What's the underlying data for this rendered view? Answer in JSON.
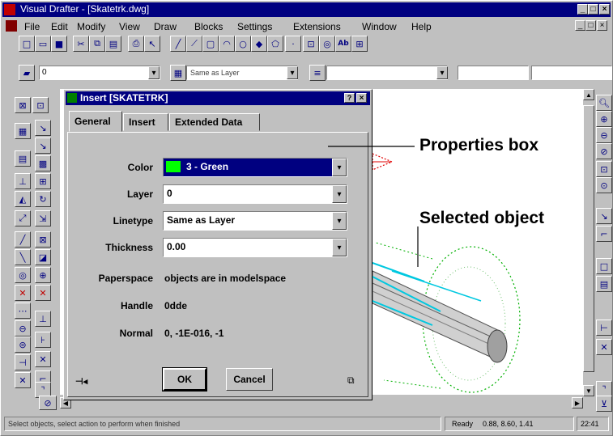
{
  "window": {
    "title": "Visual Drafter - [Skatetrk.dwg]"
  },
  "menu": [
    "File",
    "Edit",
    "Modify",
    "View",
    "Draw",
    "Blocks",
    "Settings",
    "Extensions",
    "Window",
    "Help"
  ],
  "toolbar2": {
    "layer_field": "0",
    "layer_combo": "Same as Layer"
  },
  "dialog": {
    "title": "Insert [SKATETRK]",
    "tabs": [
      "General",
      "Insert",
      "Extended Data"
    ],
    "color_label": "Color",
    "color_value": "3 - Green",
    "color_swatch": "#00ff00",
    "layer_label": "Layer",
    "layer_value": "0",
    "linetype_label": "Linetype",
    "linetype_value": "Same as Layer",
    "thickness_label": "Thickness",
    "thickness_value": "0.00",
    "paperspace_label": "Paperspace",
    "paperspace_value": "objects are in modelspace",
    "handle_label": "Handle",
    "handle_value": "0dde",
    "normal_label": "Normal",
    "normal_value": "0, -1E-016, -1",
    "ok_label": "OK",
    "cancel_label": "Cancel"
  },
  "callouts": {
    "properties": "Properties box",
    "selected": "Selected object"
  },
  "status": {
    "prompt": "Select objects, select action to perform when finished",
    "ready": "Ready",
    "coords": "0.88, 8.60, 1.41",
    "time": "22:41"
  }
}
